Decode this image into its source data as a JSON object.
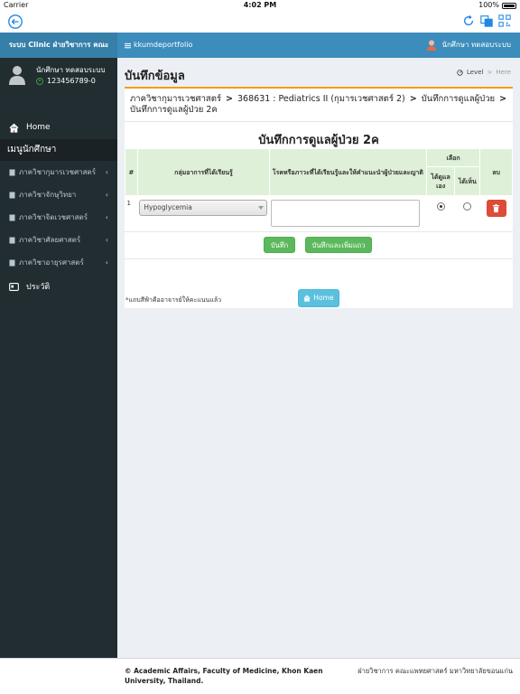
{
  "status_bar": {
    "carrier": "Carrier",
    "time": "4:02 PM",
    "battery": "100%"
  },
  "sidebar": {
    "brand": "ระบบ Clinic ฝ่ายวิชาการ คณะ",
    "user_name": "นักศึกษา ทดสอบระบบ",
    "user_id": "123456789-0",
    "home_label": "Home",
    "menu_header": "เมนูนักศึกษา",
    "items": [
      {
        "label": "ภาควิชากุมารเวชศาสตร์"
      },
      {
        "label": "ภาควิชาจักษุวิทยา"
      },
      {
        "label": "ภาควิชาจิตเวชศาสตร์"
      },
      {
        "label": "ภาควิชาศัลยศาสตร์"
      },
      {
        "label": "ภาควิชาอายุรศาสตร์"
      }
    ],
    "history_label": "ประวัติ"
  },
  "topnav": {
    "portfolio_label": "kkumdeportfolio",
    "user_label": "นักศึกษา ทดสอบระบบ"
  },
  "page": {
    "title": "บันทึกข้อมูล",
    "breadcrumb_level": "Level",
    "breadcrumb_here": "Here"
  },
  "record": {
    "subject_dept": "ภาควิชากุมารเวชศาสตร์",
    "subject_course": "368631 : Pediatrics II (กุมารเวชศาสตร์ 2)",
    "subject_task": "บันทึกการดูแลผู้ป่วย",
    "subject_sub": "บันทึกการดูแลผู้ป่วย 2ค",
    "box_title": "บันทึกการดูแลผู้ป่วย 2ค",
    "table": {
      "col_num": "#",
      "col_symptom": "กลุ่มอาการที่ได้เรียนรู้",
      "col_disease": "โรคหรือภาวะที่ได้เรียนรู้และให้คำแนะนำผู้ป่วยและญาติ",
      "col_choose": "เลือก",
      "col_self": "ได้ดูแลเอง",
      "col_seen": "ได้เห็น",
      "col_delete": "ลบ",
      "rows": [
        {
          "num": "1",
          "symptom": "Hypoglycemia",
          "disease": "",
          "self_selected": true,
          "seen_selected": false
        }
      ]
    },
    "save_label": "บันทึก",
    "save_add_label": "บันทึกและเพิ่มแถว",
    "note": "*แถบสีฟ้าคืออาจารย์ให้คะแนนแล้ว"
  },
  "home_button": "Home",
  "footer": {
    "left": "© Academic Affairs, Faculty of Medicine, Khon Kaen University, Thailand.",
    "right": "ฝ่ายวิชาการ คณะแพทยศาสตร์ มหาวิทยาลัยขอนแก่น"
  },
  "colors": {
    "brand": "#367fa9",
    "topnav": "#3c8dbc",
    "sidebar": "#222d32",
    "accent_border": "#f39c12",
    "success": "#5cb85c",
    "danger": "#dd4b39",
    "info": "#5bc0de"
  }
}
